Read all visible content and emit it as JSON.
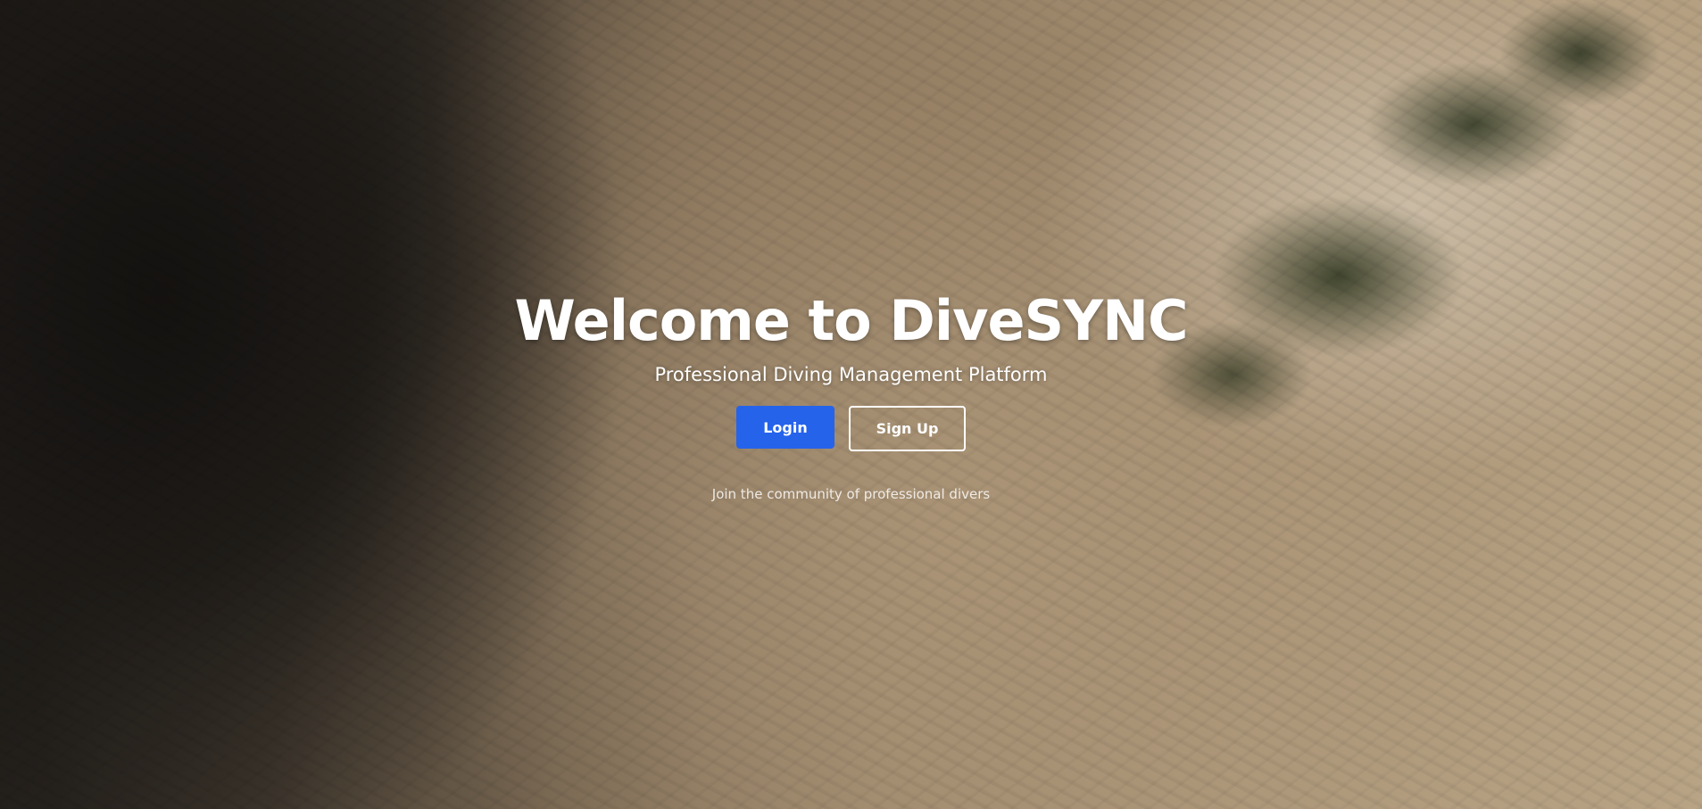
{
  "hero": {
    "title": "Welcome to DiveSYNC",
    "subtitle": "Professional Diving Management Platform",
    "login_label": "Login",
    "signup_label": "Sign Up",
    "footnote": "Join the community of professional divers"
  },
  "colors": {
    "primary": "#2563eb",
    "text": "#ffffff"
  },
  "background": {
    "description_icon": "aerial-sand-dunes-image"
  }
}
